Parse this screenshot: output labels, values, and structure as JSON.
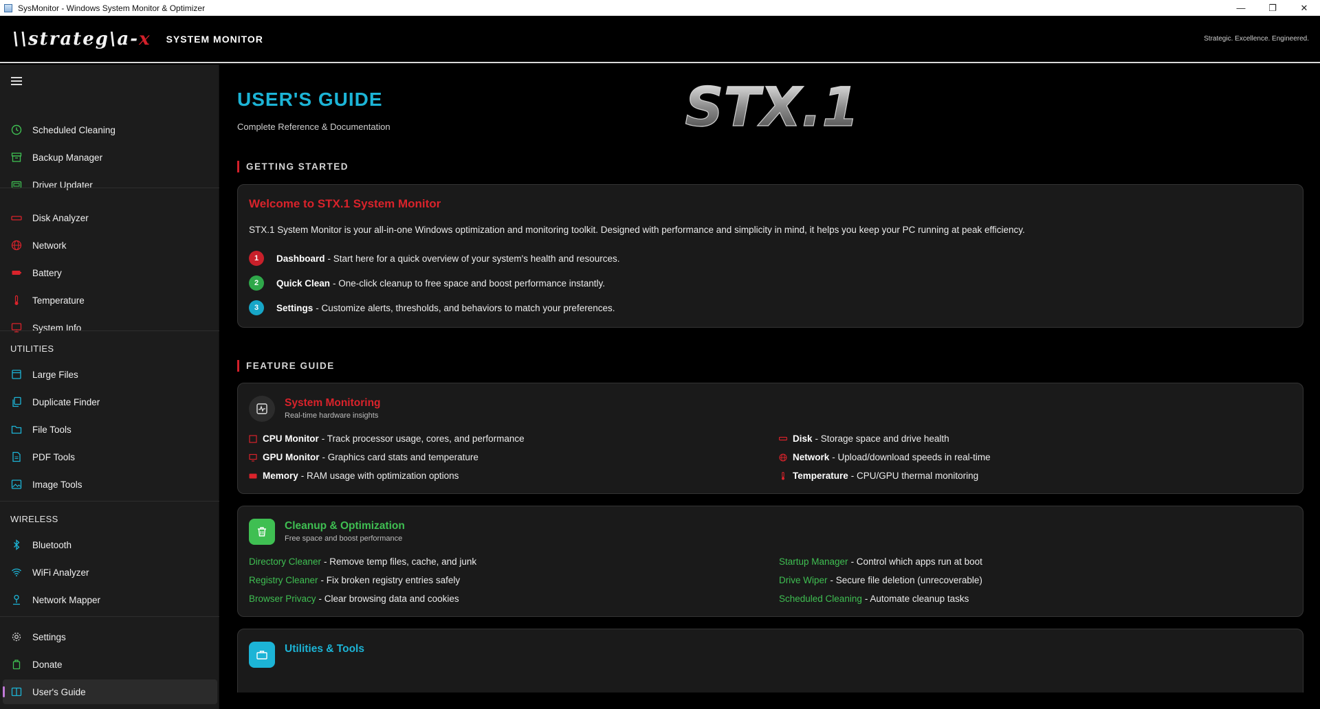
{
  "window": {
    "title": "SysMonitor - Windows System Monitor & Optimizer",
    "controls": {
      "minimize": "—",
      "restore": "❐",
      "close": "✕"
    }
  },
  "header": {
    "logo_main": "\\\\strateg\\a-",
    "logo_x": "x",
    "title": "SYSTEM MONITOR",
    "tagline": "Strategic. Excellence. Engineered."
  },
  "sidebar": {
    "group1": [
      {
        "label": "Scheduled Cleaning",
        "icon": "clock-icon",
        "color": "#3fbf52"
      },
      {
        "label": "Backup Manager",
        "icon": "archive-icon",
        "color": "#3fbf52"
      },
      {
        "label": "Driver Updater",
        "icon": "chip-icon",
        "color": "#3fbf52"
      }
    ],
    "group2": [
      {
        "label": "Disk Analyzer",
        "icon": "disk-icon",
        "color": "#d9232b"
      },
      {
        "label": "Network",
        "icon": "globe-icon",
        "color": "#d9232b"
      },
      {
        "label": "Battery",
        "icon": "battery-icon",
        "color": "#d9232b"
      },
      {
        "label": "Temperature",
        "icon": "thermometer-icon",
        "color": "#d9232b"
      },
      {
        "label": "System Info",
        "icon": "monitor-icon",
        "color": "#d9232b"
      }
    ],
    "utilities_heading": "UTILITIES",
    "utilities": [
      {
        "label": "Large Files",
        "icon": "file-stack-icon",
        "color": "#1cb4d6"
      },
      {
        "label": "Duplicate Finder",
        "icon": "copy-icon",
        "color": "#1cb4d6"
      },
      {
        "label": "File Tools",
        "icon": "folder-icon",
        "color": "#1cb4d6"
      },
      {
        "label": "PDF Tools",
        "icon": "pdf-icon",
        "color": "#1cb4d6"
      },
      {
        "label": "Image Tools",
        "icon": "image-icon",
        "color": "#1cb4d6"
      }
    ],
    "wireless_heading": "WIRELESS",
    "wireless": [
      {
        "label": "Bluetooth",
        "icon": "bluetooth-icon",
        "color": "#1cb4d6"
      },
      {
        "label": "WiFi Analyzer",
        "icon": "wifi-icon",
        "color": "#1cb4d6"
      },
      {
        "label": "Network Mapper",
        "icon": "network-mapper-icon",
        "color": "#1cb4d6"
      }
    ],
    "bottom": [
      {
        "label": "Settings",
        "icon": "gear-icon",
        "color": "#cfcfcf"
      },
      {
        "label": "Donate",
        "icon": "donate-icon",
        "color": "#3fbf52"
      },
      {
        "label": "User's Guide",
        "icon": "book-icon",
        "color": "#1cb4d6"
      }
    ]
  },
  "main": {
    "title": "USER'S GUIDE",
    "subtitle": "Complete Reference & Documentation",
    "logo_text": "STX.1",
    "getting_started": {
      "heading": "GETTING STARTED",
      "card_title": "Welcome to STX.1 System Monitor",
      "intro": "STX.1 System Monitor is your all-in-one Windows optimization and monitoring toolkit. Designed with performance and simplicity in mind, it helps you keep your PC running at peak efficiency.",
      "steps": [
        {
          "num": "1",
          "title": "Dashboard",
          "text": "- Start here for a quick overview of your system's health and resources.",
          "color": "#c8202a"
        },
        {
          "num": "2",
          "title": "Quick Clean",
          "text": "- One-click cleanup to free space and boost performance instantly.",
          "color": "#2fa84a"
        },
        {
          "num": "3",
          "title": "Settings",
          "text": "- Customize alerts, thresholds, and behaviors to match your preferences.",
          "color": "#17a6c7"
        }
      ]
    },
    "feature_guide": {
      "heading": "FEATURE GUIDE",
      "monitoring": {
        "title": "System Monitoring",
        "subtitle": "Real-time hardware insights",
        "left": [
          {
            "title": "CPU Monitor",
            "text": "- Track processor usage, cores, and performance",
            "icon": "cpu-icon"
          },
          {
            "title": "GPU Monitor",
            "text": "- Graphics card stats and temperature",
            "icon": "gpu-icon"
          },
          {
            "title": "Memory",
            "text": "- RAM usage with optimization options",
            "icon": "memory-icon"
          }
        ],
        "right": [
          {
            "title": "Disk",
            "text": "- Storage space and drive health",
            "icon": "disk-icon"
          },
          {
            "title": "Network",
            "text": "- Upload/download speeds in real-time",
            "icon": "globe-icon"
          },
          {
            "title": "Temperature",
            "text": "- CPU/GPU thermal monitoring",
            "icon": "thermometer-icon"
          }
        ]
      },
      "cleanup": {
        "title": "Cleanup & Optimization",
        "subtitle": "Free space and boost performance",
        "left": [
          {
            "title": "Directory Cleaner",
            "text": "- Remove temp files, cache, and junk"
          },
          {
            "title": "Registry Cleaner",
            "text": "- Fix broken registry entries safely"
          },
          {
            "title": "Browser Privacy",
            "text": "- Clear browsing data and cookies"
          }
        ],
        "right": [
          {
            "title": "Startup Manager",
            "text": "- Control which apps run at boot"
          },
          {
            "title": "Drive Wiper",
            "text": "- Secure file deletion (unrecoverable)"
          },
          {
            "title": "Scheduled Cleaning",
            "text": "- Automate cleanup tasks"
          }
        ]
      },
      "utilities": {
        "title": "Utilities & Tools"
      }
    }
  },
  "colors": {
    "accent_red": "#d9232b",
    "accent_cyan": "#1cb4d6",
    "accent_green": "#3fbf52"
  }
}
